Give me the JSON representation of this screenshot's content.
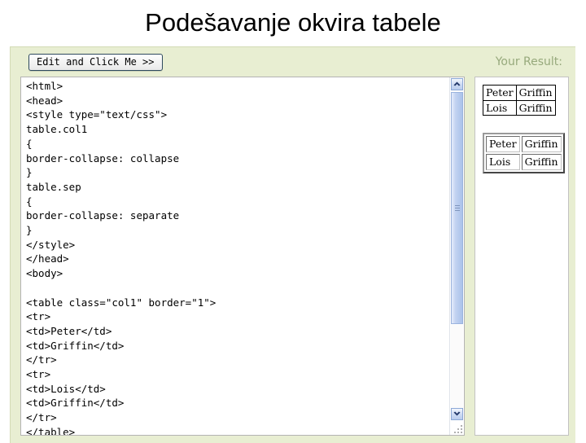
{
  "slide": {
    "title": "Podešavanje okvira tabele"
  },
  "widget": {
    "edit_button_label": "Edit and Click Me >>",
    "result_label": "Your Result:",
    "code": "<html>\n<head>\n<style type=\"text/css\">\ntable.col1\n{\nborder-collapse: collapse\n}\ntable.sep\n{\nborder-collapse: separate\n}\n</style>\n</head>\n<body>\n\n<table class=\"col1\" border=\"1\">\n<tr>\n<td>Peter</td>\n<td>Griffin</td>\n</tr>\n<tr>\n<td>Lois</td>\n<td>Griffin</td>\n</tr>\n</table>",
    "scrollbar": {
      "up_arrow": "chevron-up-icon",
      "down_arrow": "chevron-down-icon",
      "resize_grip": "resize-grip-icon"
    }
  },
  "result": {
    "tables": [
      {
        "style": "collapse",
        "rows": [
          {
            "first": "Peter",
            "last": "Griffin"
          },
          {
            "first": "Lois",
            "last": "Griffin"
          }
        ]
      },
      {
        "style": "separate",
        "rows": [
          {
            "first": "Peter",
            "last": "Griffin"
          },
          {
            "first": "Lois",
            "last": "Griffin"
          }
        ]
      }
    ]
  },
  "colors": {
    "widget_background": "#e8eed2",
    "result_label_text": "#97a97c",
    "panel_background": "#ffffff",
    "scrollbar_thumb": "#aac2ea",
    "title_text": "#000000"
  }
}
